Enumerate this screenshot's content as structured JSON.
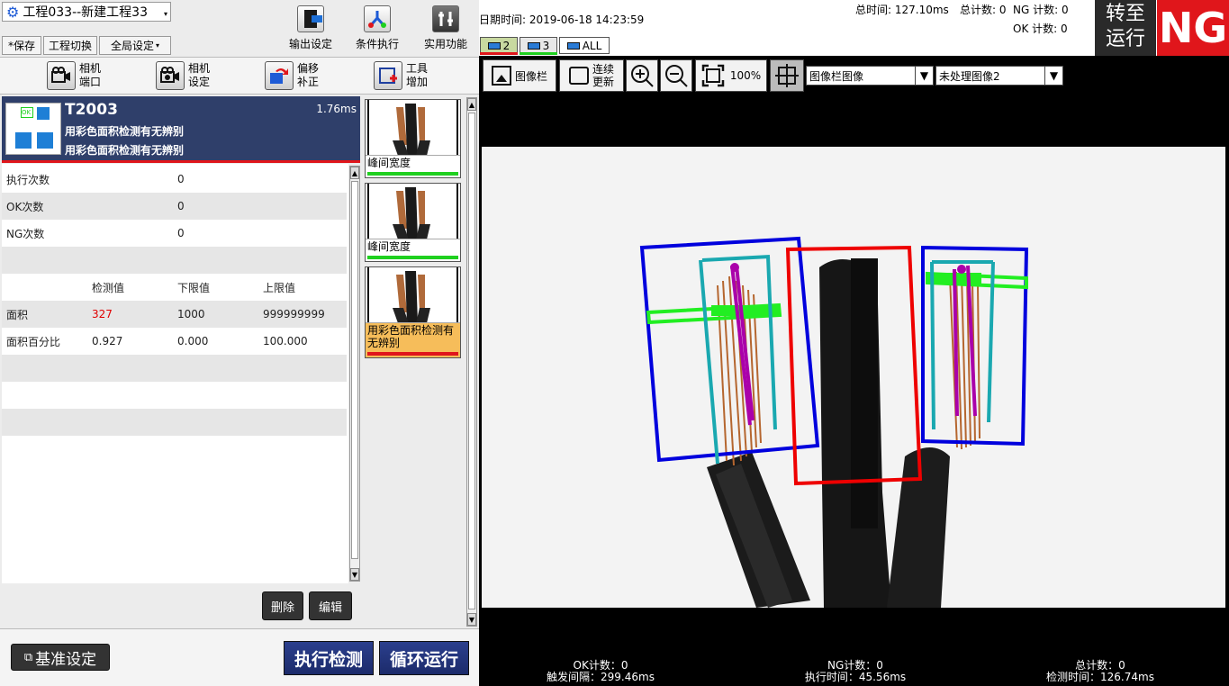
{
  "project": {
    "title": "工程033--新建工程33"
  },
  "toolbar": {
    "save_label": "*保存",
    "switch_label": "工程切换",
    "global_label": "全局设定",
    "output_label": "输出设定",
    "condition_label": "条件执行",
    "utility_label": "实用功能"
  },
  "tools": {
    "camera_port_1": "相机",
    "camera_port_2": "端口",
    "camera_set_1": "相机",
    "camera_set_2": "设定",
    "offset_1": "偏移",
    "offset_2": "补正",
    "tooladd_1": "工具",
    "tooladd_2": "增加"
  },
  "current": {
    "id": "T2003",
    "time": "1.76ms",
    "name1": "用彩色面积检测有无辨别",
    "name2": "用彩色面积检测有无辨别"
  },
  "stats": {
    "exec_label": "执行次数",
    "exec_val": "0",
    "ok_label": "OK次数",
    "ok_val": "0",
    "ng_label": "NG次数",
    "ng_val": "0"
  },
  "table": {
    "col_measure": "检测值",
    "col_lower": "下限值",
    "col_upper": "上限值",
    "r1_name": "面积",
    "r1_measure": "327",
    "r1_lower": "1000",
    "r1_upper": "999999999",
    "r2_name": "面积百分比",
    "r2_measure": "0.927",
    "r2_lower": "0.000",
    "r2_upper": "100.000"
  },
  "thumbs": {
    "t1": "峰间宽度",
    "t2": "峰间宽度",
    "t3": "用彩色面积检测有无辨别"
  },
  "buttons": {
    "delete": "删除",
    "edit": "编辑",
    "baseline": "基准设定",
    "execute": "执行检测",
    "loop": "循环运行"
  },
  "header": {
    "datetime_label": "日期时间: 2019-06-18 14:23:59",
    "total_time": "总时间: 127.10ms",
    "total_count": "总计数: 0",
    "ng_count": "NG 计数: 0",
    "ok_count": "OK 计数: 0",
    "switch_run_1": "转至",
    "switch_run_2": "运行",
    "result": "NG"
  },
  "camera_tabs": {
    "c1": "2",
    "c2": "3",
    "all": "ALL"
  },
  "viewer": {
    "imagebar": "图像栏",
    "continuous_1": "连续",
    "continuous_2": "更新",
    "zoom": "100%",
    "select1": "图像栏图像",
    "select2": "未处理图像2"
  },
  "status": {
    "ok_count": "OK计数：0",
    "trigger": "触发间隔：299.46ms",
    "ng_count": "NG计数：0",
    "exec_time": "执行时间：45.56ms",
    "total_count": "总计数：0",
    "detect_time": "检测时间：126.74ms"
  },
  "colors": {
    "ng_red": "#e0161b",
    "value_red": "#e00000",
    "panel_blue": "#2f3f6a",
    "ok_green": "#1fd01f"
  }
}
